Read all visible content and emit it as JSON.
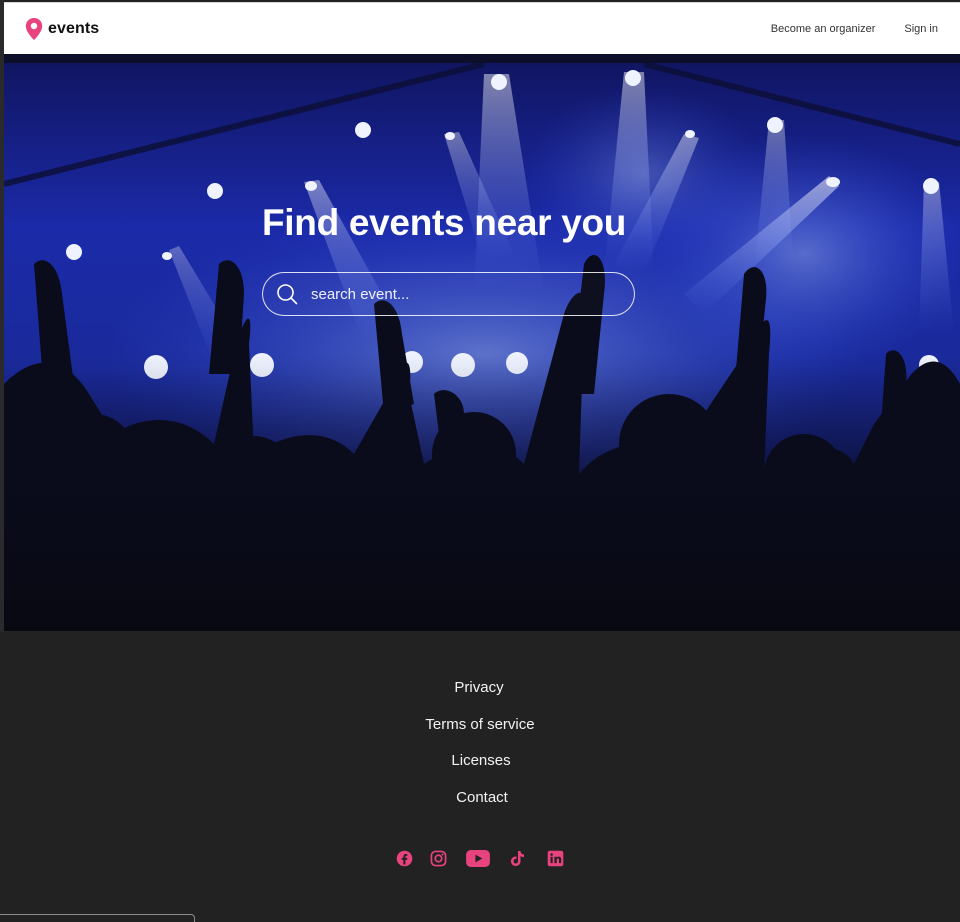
{
  "header": {
    "brand": "events",
    "nav": [
      "Become an organizer",
      "Sign in"
    ],
    "brand_icon": "location-pin-icon",
    "brand_color": "#e8437f"
  },
  "hero": {
    "title": "Find events near you",
    "search": {
      "placeholder": "search event...",
      "value": "",
      "icon": "search-icon"
    }
  },
  "footer": {
    "links": [
      "Privacy",
      "Terms of service",
      "Licenses",
      "Contact"
    ],
    "socials": [
      "facebook-icon",
      "instagram-icon",
      "youtube-icon",
      "tiktok-icon",
      "linkedin-icon"
    ],
    "accent": "#e8437f",
    "background": "#222223"
  }
}
